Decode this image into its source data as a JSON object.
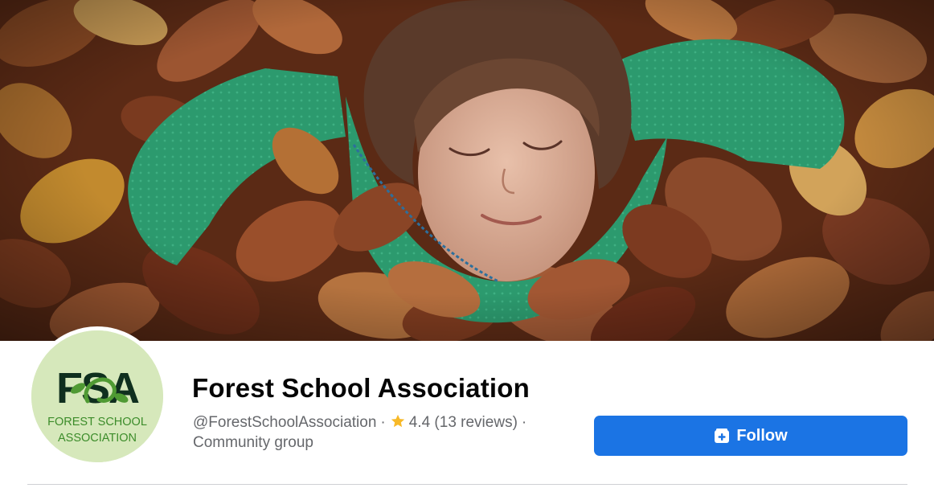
{
  "cover": {
    "image": "cover-photo-child-in-autumn-leaves"
  },
  "profile": {
    "logo": {
      "monogram": "FSA",
      "line1": "FOREST SCHOOL",
      "line2": "ASSOCIATION",
      "colors": {
        "background": "#d6e8bb",
        "monogram": "#0f2f1e",
        "accent": "#4f9a33",
        "text": "#3c8c2a"
      }
    },
    "name": "Forest School Association",
    "handle": "@ForestSchoolAssociation",
    "separator": "·",
    "rating_icon": "star-icon",
    "rating": "4.4",
    "reviews": "(13 reviews)",
    "category": "Community group"
  },
  "actions": {
    "follow_label": "Follow",
    "follow_icon": "follow-plus-icon",
    "button_color": "#1b74e4"
  }
}
